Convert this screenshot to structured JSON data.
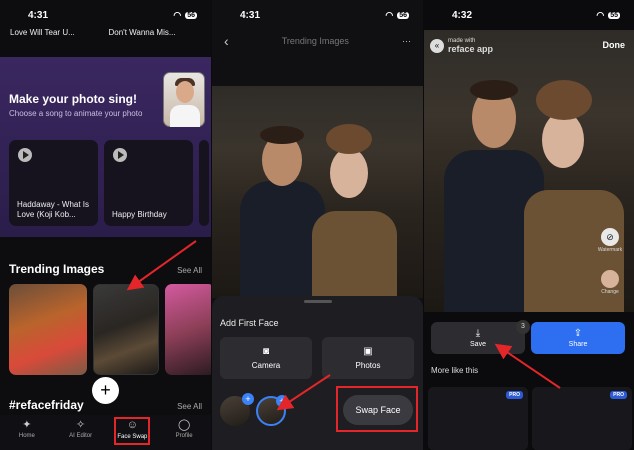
{
  "screens": {
    "home": {
      "time": "4:31",
      "battery": "56",
      "songs_top": [
        "Love Will Tear U...",
        "Don't Wanna Mis..."
      ],
      "sing": {
        "title": "Make your photo sing!",
        "subtitle": "Choose a song to animate your photo"
      },
      "song_cards": [
        "Haddaway - What Is Love (Koji Kob...",
        "Happy Birthday"
      ],
      "trending": {
        "title": "Trending Images",
        "see_all": "See All"
      },
      "refacefriday": {
        "title": "#refacefriday",
        "see_all": "See All"
      },
      "fab": "+",
      "tabs": [
        {
          "label": "Home",
          "icon": "sparkle-icon"
        },
        {
          "label": "AI Editor",
          "icon": "wand-icon"
        },
        {
          "label": "Face Swap",
          "icon": "face-icon"
        },
        {
          "label": "Profile",
          "icon": "person-icon"
        }
      ]
    },
    "detail": {
      "time": "4:31",
      "battery": "56",
      "back": "‹",
      "title": "Trending Images",
      "menu": "···",
      "sheet_title": "Add First Face",
      "camera": "Camera",
      "photos": "Photos",
      "swap": "Swap Face",
      "plus": "+"
    },
    "result": {
      "time": "4:32",
      "battery": "55",
      "made_with": "made with",
      "brand": "reface app",
      "done": "Done",
      "watermark": "Watermark",
      "change": "Change",
      "save": "Save",
      "save_count": "3",
      "share": "Share",
      "more": "More like this",
      "pro": "PRO"
    }
  },
  "colors": {
    "accent_blue": "#3b82f6",
    "highlight_red": "#e2262a"
  }
}
